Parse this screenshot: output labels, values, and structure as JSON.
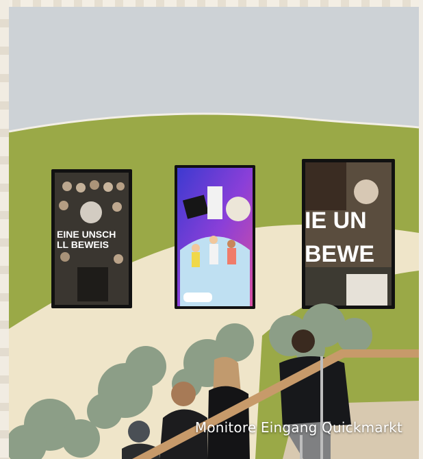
{
  "caption": "Monitore Eingang Quickmarkt",
  "monitors": {
    "left_line1": "EINE UNSCH",
    "left_line2": "LL BEWEIS",
    "right_line1": "IE UN",
    "right_line2": "BEWE"
  },
  "colors": {
    "wall_top": "#c7ccd0",
    "green": "#9aa947",
    "cream": "#efe5c9",
    "rail": "#c79a6a"
  }
}
